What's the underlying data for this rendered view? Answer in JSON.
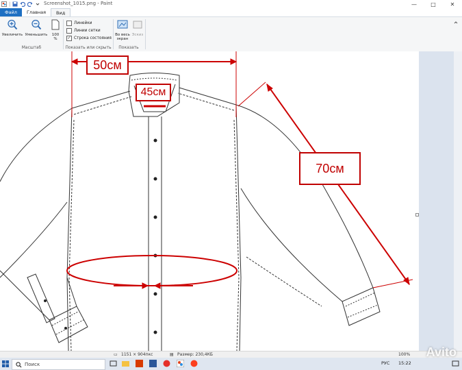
{
  "window": {
    "title": "Screenshot_1015.png - Paint",
    "controls": {
      "minimize": "—",
      "maximize": "□",
      "close": "✕"
    }
  },
  "tabs": [
    {
      "label": "Файл"
    },
    {
      "label": "Главная"
    },
    {
      "label": "Вид"
    }
  ],
  "ribbon": {
    "zoom_group": {
      "zoom_in": "Увеличить",
      "zoom_out": "Уменьшить",
      "zoom_100_line1": "100",
      "zoom_100_line2": "%",
      "label": "Масштаб"
    },
    "show_group": {
      "rulers": "Линейки",
      "gridlines": "Линии сетки",
      "statusbar": "Строка состояния",
      "statusbar_checked": "✓",
      "label": "Показать или скрыть"
    },
    "display_group": {
      "fullscreen_line1": "Во весь",
      "fullscreen_line2": "экран",
      "thumbnail": "Эскиз",
      "label": "Показать"
    }
  },
  "canvas": {
    "labels": {
      "shoulder": "50см",
      "collar": "45см",
      "sleeve": "70см"
    },
    "annotation_color": "#cc0000"
  },
  "statusbar": {
    "dimensions": "1151 × 904пкс",
    "filesize": "Размер: 230,4КБ",
    "zoom": "100%"
  },
  "taskbar": {
    "search_placeholder": "Поиск",
    "language": "РУС",
    "time": "15:22"
  },
  "watermark": "Avito"
}
